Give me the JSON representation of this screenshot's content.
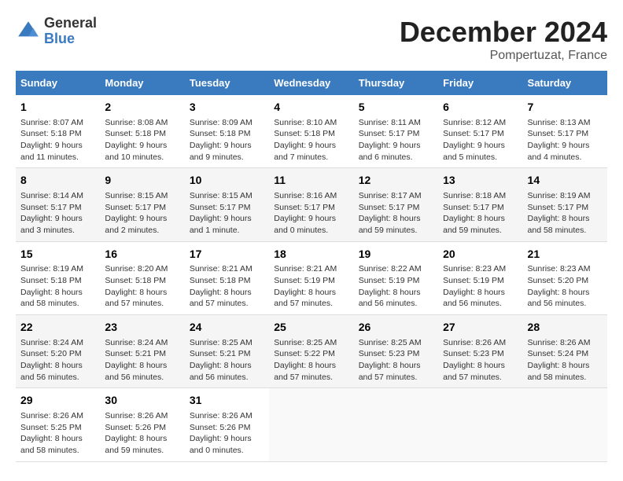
{
  "header": {
    "logo_line1": "General",
    "logo_line2": "Blue",
    "title": "December 2024",
    "subtitle": "Pompertuzat, France"
  },
  "weekdays": [
    "Sunday",
    "Monday",
    "Tuesday",
    "Wednesday",
    "Thursday",
    "Friday",
    "Saturday"
  ],
  "weeks": [
    [
      {
        "day": "1",
        "info": "Sunrise: 8:07 AM\nSunset: 5:18 PM\nDaylight: 9 hours\nand 11 minutes."
      },
      {
        "day": "2",
        "info": "Sunrise: 8:08 AM\nSunset: 5:18 PM\nDaylight: 9 hours\nand 10 minutes."
      },
      {
        "day": "3",
        "info": "Sunrise: 8:09 AM\nSunset: 5:18 PM\nDaylight: 9 hours\nand 9 minutes."
      },
      {
        "day": "4",
        "info": "Sunrise: 8:10 AM\nSunset: 5:18 PM\nDaylight: 9 hours\nand 7 minutes."
      },
      {
        "day": "5",
        "info": "Sunrise: 8:11 AM\nSunset: 5:17 PM\nDaylight: 9 hours\nand 6 minutes."
      },
      {
        "day": "6",
        "info": "Sunrise: 8:12 AM\nSunset: 5:17 PM\nDaylight: 9 hours\nand 5 minutes."
      },
      {
        "day": "7",
        "info": "Sunrise: 8:13 AM\nSunset: 5:17 PM\nDaylight: 9 hours\nand 4 minutes."
      }
    ],
    [
      {
        "day": "8",
        "info": "Sunrise: 8:14 AM\nSunset: 5:17 PM\nDaylight: 9 hours\nand 3 minutes."
      },
      {
        "day": "9",
        "info": "Sunrise: 8:15 AM\nSunset: 5:17 PM\nDaylight: 9 hours\nand 2 minutes."
      },
      {
        "day": "10",
        "info": "Sunrise: 8:15 AM\nSunset: 5:17 PM\nDaylight: 9 hours\nand 1 minute."
      },
      {
        "day": "11",
        "info": "Sunrise: 8:16 AM\nSunset: 5:17 PM\nDaylight: 9 hours\nand 0 minutes."
      },
      {
        "day": "12",
        "info": "Sunrise: 8:17 AM\nSunset: 5:17 PM\nDaylight: 8 hours\nand 59 minutes."
      },
      {
        "day": "13",
        "info": "Sunrise: 8:18 AM\nSunset: 5:17 PM\nDaylight: 8 hours\nand 59 minutes."
      },
      {
        "day": "14",
        "info": "Sunrise: 8:19 AM\nSunset: 5:17 PM\nDaylight: 8 hours\nand 58 minutes."
      }
    ],
    [
      {
        "day": "15",
        "info": "Sunrise: 8:19 AM\nSunset: 5:18 PM\nDaylight: 8 hours\nand 58 minutes."
      },
      {
        "day": "16",
        "info": "Sunrise: 8:20 AM\nSunset: 5:18 PM\nDaylight: 8 hours\nand 57 minutes."
      },
      {
        "day": "17",
        "info": "Sunrise: 8:21 AM\nSunset: 5:18 PM\nDaylight: 8 hours\nand 57 minutes."
      },
      {
        "day": "18",
        "info": "Sunrise: 8:21 AM\nSunset: 5:19 PM\nDaylight: 8 hours\nand 57 minutes."
      },
      {
        "day": "19",
        "info": "Sunrise: 8:22 AM\nSunset: 5:19 PM\nDaylight: 8 hours\nand 56 minutes."
      },
      {
        "day": "20",
        "info": "Sunrise: 8:23 AM\nSunset: 5:19 PM\nDaylight: 8 hours\nand 56 minutes."
      },
      {
        "day": "21",
        "info": "Sunrise: 8:23 AM\nSunset: 5:20 PM\nDaylight: 8 hours\nand 56 minutes."
      }
    ],
    [
      {
        "day": "22",
        "info": "Sunrise: 8:24 AM\nSunset: 5:20 PM\nDaylight: 8 hours\nand 56 minutes."
      },
      {
        "day": "23",
        "info": "Sunrise: 8:24 AM\nSunset: 5:21 PM\nDaylight: 8 hours\nand 56 minutes."
      },
      {
        "day": "24",
        "info": "Sunrise: 8:25 AM\nSunset: 5:21 PM\nDaylight: 8 hours\nand 56 minutes."
      },
      {
        "day": "25",
        "info": "Sunrise: 8:25 AM\nSunset: 5:22 PM\nDaylight: 8 hours\nand 57 minutes."
      },
      {
        "day": "26",
        "info": "Sunrise: 8:25 AM\nSunset: 5:23 PM\nDaylight: 8 hours\nand 57 minutes."
      },
      {
        "day": "27",
        "info": "Sunrise: 8:26 AM\nSunset: 5:23 PM\nDaylight: 8 hours\nand 57 minutes."
      },
      {
        "day": "28",
        "info": "Sunrise: 8:26 AM\nSunset: 5:24 PM\nDaylight: 8 hours\nand 58 minutes."
      }
    ],
    [
      {
        "day": "29",
        "info": "Sunrise: 8:26 AM\nSunset: 5:25 PM\nDaylight: 8 hours\nand 58 minutes."
      },
      {
        "day": "30",
        "info": "Sunrise: 8:26 AM\nSunset: 5:26 PM\nDaylight: 8 hours\nand 59 minutes."
      },
      {
        "day": "31",
        "info": "Sunrise: 8:26 AM\nSunset: 5:26 PM\nDaylight: 9 hours\nand 0 minutes."
      },
      null,
      null,
      null,
      null
    ]
  ]
}
